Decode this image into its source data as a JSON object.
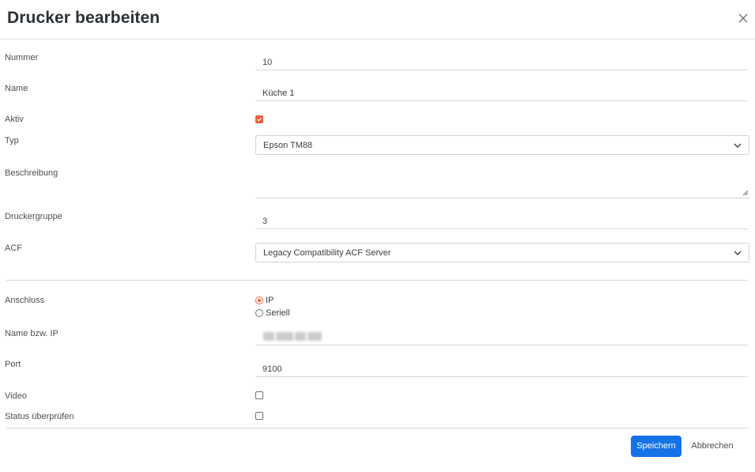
{
  "dialog": {
    "title": "Drucker bearbeiten",
    "close_icon": "close-icon"
  },
  "form": {
    "nummer": {
      "label": "Nummer",
      "value": "10"
    },
    "name": {
      "label": "Name",
      "value": "Küche 1"
    },
    "aktiv": {
      "label": "Aktiv",
      "checked": true
    },
    "typ": {
      "label": "Typ",
      "selected": "Epson TM88"
    },
    "beschreibung": {
      "label": "Beschreibung",
      "value": ""
    },
    "druckergruppe": {
      "label": "Druckergruppe",
      "value": "3"
    },
    "acf": {
      "label": "ACF",
      "selected": "Legacy Compatibility ACF Server"
    },
    "anschluss": {
      "label": "Anschluss",
      "options": [
        {
          "label": "IP",
          "checked": true
        },
        {
          "label": "Seriell",
          "checked": false
        }
      ]
    },
    "name_ip": {
      "label": "Name bzw. IP"
    },
    "port": {
      "label": "Port",
      "value": "9100"
    },
    "video": {
      "label": "Video",
      "checked": false
    },
    "status": {
      "label": "Status überprüfen",
      "checked": false
    }
  },
  "footer": {
    "save_label": "Speichern",
    "cancel_label": "Abbrechen"
  },
  "colors": {
    "accent": "#e8603c",
    "primary_button": "#1573e8"
  }
}
